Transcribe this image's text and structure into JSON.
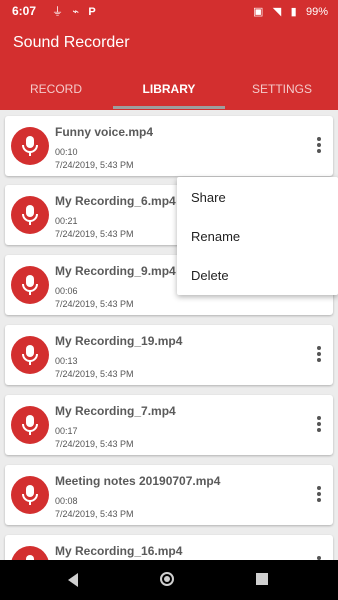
{
  "status": {
    "time": "6:07",
    "battery": "99%"
  },
  "app": {
    "title": "Sound Recorder"
  },
  "tabs": [
    {
      "label": "RECORD"
    },
    {
      "label": "LIBRARY"
    },
    {
      "label": "SETTINGS"
    }
  ],
  "recordings": [
    {
      "name": "Funny voice.mp4",
      "duration": "00:10",
      "date": "7/24/2019, 5:43 PM"
    },
    {
      "name": "My Recording_6.mp4",
      "duration": "00:21",
      "date": "7/24/2019, 5:43 PM"
    },
    {
      "name": "My Recording_9.mp4",
      "duration": "00:06",
      "date": "7/24/2019, 5:43 PM"
    },
    {
      "name": "My Recording_19.mp4",
      "duration": "00:13",
      "date": "7/24/2019, 5:43 PM"
    },
    {
      "name": "My Recording_7.mp4",
      "duration": "00:17",
      "date": "7/24/2019, 5:43 PM"
    },
    {
      "name": "Meeting notes 20190707.mp4",
      "duration": "00:08",
      "date": "7/24/2019, 5:43 PM"
    },
    {
      "name": "My Recording_16.mp4",
      "duration": "",
      "date": ""
    }
  ],
  "context_menu": {
    "items": [
      {
        "label": "Share"
      },
      {
        "label": "Rename"
      },
      {
        "label": "Delete"
      }
    ]
  },
  "colors": {
    "primary": "#d32f2f",
    "background": "#ececec"
  }
}
